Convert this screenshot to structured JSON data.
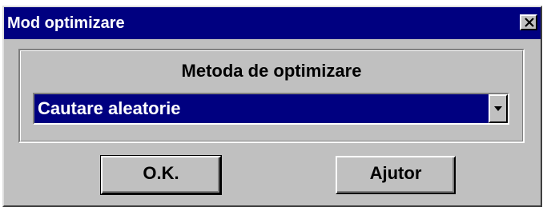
{
  "window": {
    "title": "Mod optimizare"
  },
  "group": {
    "label": "Metoda de optimizare"
  },
  "method_select": {
    "selected": "Cautare aleatorie"
  },
  "buttons": {
    "ok_label": "O.K.",
    "help_label": "Ajutor"
  },
  "colors": {
    "titlebar": "#000080",
    "face": "#c0c0c0",
    "selection": "#000080"
  },
  "icons": {
    "close": "close-icon",
    "dropdown": "chevron-down-icon"
  }
}
